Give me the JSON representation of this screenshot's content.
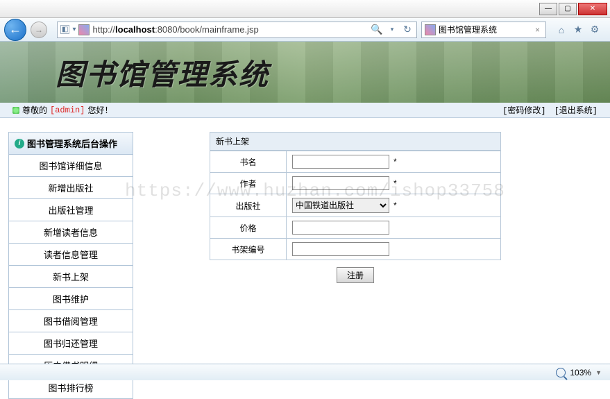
{
  "window": {
    "url_prefix": "http://",
    "url_host": "localhost",
    "url_rest": ":8080/book/mainframe.jsp",
    "tab_title": "图书馆管理系统"
  },
  "banner": {
    "title": "图书馆管理系统"
  },
  "greeting": {
    "prefix": "尊敬的 ",
    "user": "[admin]",
    "suffix": " 您好！",
    "change_pwd": "[密码修改]",
    "logout": "[退出系统]"
  },
  "sidebar": {
    "header": "图书管理系统后台操作",
    "items": [
      "图书馆详细信息",
      "新增出版社",
      "出版社管理",
      "新增读者信息",
      "读者信息管理",
      "新书上架",
      "图书维护",
      "图书借阅管理",
      "图书归还管理",
      "历史借书明细",
      "图书排行榜"
    ]
  },
  "form": {
    "title": "新书上架",
    "fields": {
      "name": {
        "label": "书名",
        "value": "",
        "required": "*"
      },
      "author": {
        "label": "作者",
        "value": "",
        "required": "*"
      },
      "publisher": {
        "label": "出版社",
        "selected": "中国铁道出版社",
        "required": "*"
      },
      "price": {
        "label": "价格",
        "value": ""
      },
      "shelf": {
        "label": "书架编号",
        "value": ""
      }
    },
    "submit": "注册"
  },
  "watermark": "https://www.huzhan.com/ishop33758",
  "status": {
    "zoom": "103%"
  }
}
